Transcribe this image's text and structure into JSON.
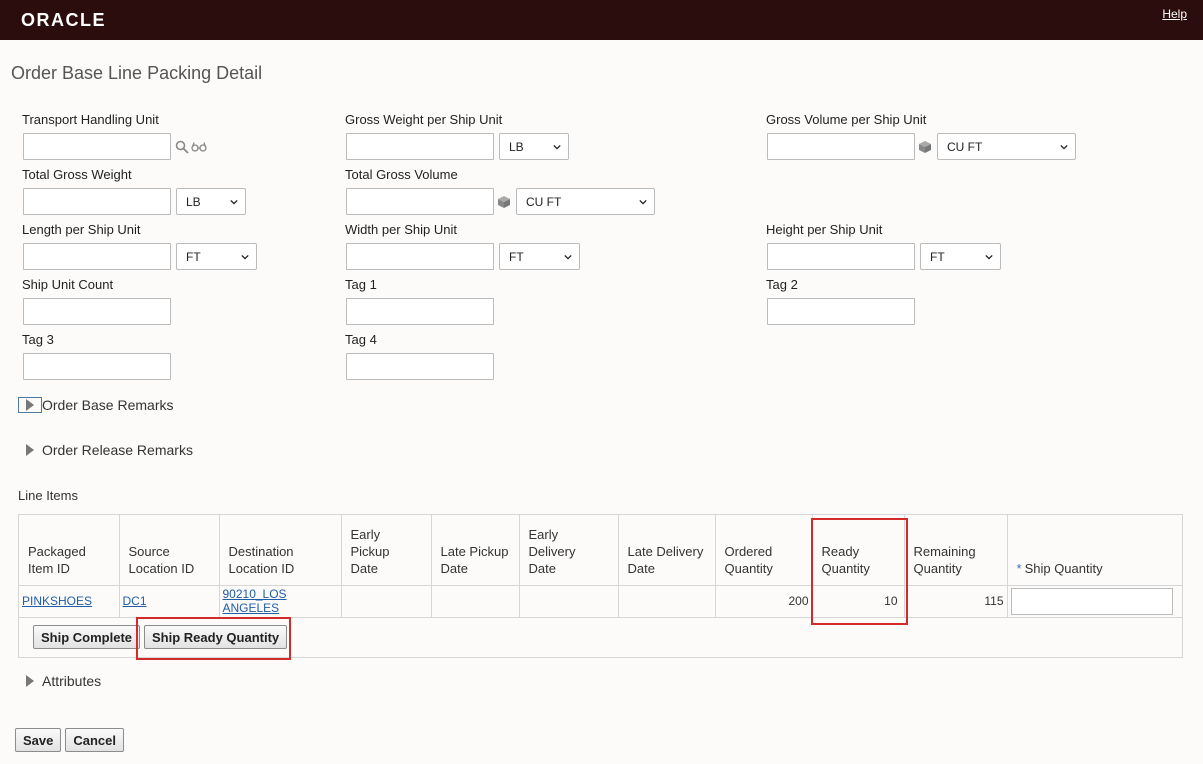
{
  "header": {
    "logo": "ORACLE",
    "help": "Help"
  },
  "page_title": "Order Base Line Packing Detail",
  "fields": {
    "thu": {
      "label": "Transport Handling Unit",
      "value": ""
    },
    "gross_weight_ship_unit": {
      "label": "Gross Weight per Ship Unit",
      "value": "",
      "unit": "LB"
    },
    "gross_volume_ship_unit": {
      "label": "Gross Volume per Ship Unit",
      "value": "",
      "unit": "CU FT"
    },
    "total_gross_weight": {
      "label": "Total Gross Weight",
      "value": "",
      "unit": "LB"
    },
    "total_gross_volume": {
      "label": "Total Gross Volume",
      "value": "",
      "unit": "CU FT"
    },
    "length_ship_unit": {
      "label": "Length per Ship Unit",
      "value": "",
      "unit": "FT"
    },
    "width_ship_unit": {
      "label": "Width per Ship Unit",
      "value": "",
      "unit": "FT"
    },
    "height_ship_unit": {
      "label": "Height per Ship Unit",
      "value": "",
      "unit": "FT"
    },
    "ship_unit_count": {
      "label": "Ship Unit Count",
      "value": ""
    },
    "tag1": {
      "label": "Tag 1",
      "value": ""
    },
    "tag2": {
      "label": "Tag 2",
      "value": ""
    },
    "tag3": {
      "label": "Tag 3",
      "value": ""
    },
    "tag4": {
      "label": "Tag 4",
      "value": ""
    }
  },
  "sections": {
    "order_base_remarks": "Order Base Remarks",
    "order_release_remarks": "Order Release Remarks",
    "line_items": "Line Items",
    "attributes": "Attributes"
  },
  "grid": {
    "headers": {
      "packaged_item_id": [
        "Packaged",
        "Item ID"
      ],
      "source_location_id": [
        "Source",
        "Location ID"
      ],
      "destination_location_id": [
        "Destination",
        "Location ID"
      ],
      "early_pickup_date": [
        "Early",
        "Pickup",
        "Date"
      ],
      "late_pickup_date": [
        "Late Pickup",
        "Date"
      ],
      "early_delivery_date": [
        "Early",
        "Delivery",
        "Date"
      ],
      "late_delivery_date": [
        "Late Delivery",
        "Date"
      ],
      "ordered_quantity": [
        "Ordered",
        "Quantity"
      ],
      "ready_quantity": [
        "Ready",
        "Quantity"
      ],
      "remaining_quantity": [
        "Remaining",
        "Quantity"
      ],
      "ship_quantity": "Ship Quantity"
    },
    "required_marker": "*",
    "rows": [
      {
        "packaged_item_id": "PINKSHOES",
        "source_location_id": "DC1",
        "destination_location_id": "90210_LOS ANGELES",
        "early_pickup_date": "",
        "late_pickup_date": "",
        "early_delivery_date": "",
        "late_delivery_date": "",
        "ordered_quantity": "200",
        "ready_quantity": "10",
        "remaining_quantity": "115",
        "ship_quantity": ""
      }
    ],
    "buttons": {
      "ship_complete": "Ship Complete",
      "ship_ready_quantity": "Ship Ready Quantity"
    }
  },
  "footer_buttons": {
    "save": "Save",
    "cancel": "Cancel"
  },
  "colors": {
    "topbar": "#2b0d0d",
    "highlight": "#d32b2b",
    "link": "#1f5da8"
  },
  "icons": {
    "search": "search-icon",
    "view": "glasses-icon",
    "volume": "cube-icon"
  }
}
